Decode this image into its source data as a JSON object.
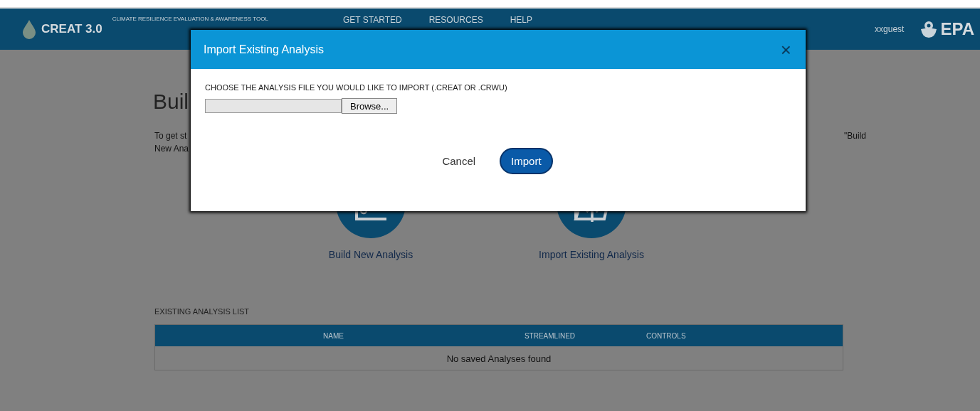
{
  "header": {
    "logo": "CREAT 3.0",
    "tagline": "CLIMATE RESILIENCE EVALUATION & AWARENESS TOOL",
    "nav": [
      {
        "label": "GET STARTED"
      },
      {
        "label": "RESOURCES"
      },
      {
        "label": "HELP"
      }
    ],
    "user": "xxguest",
    "agency_logo": "EPA"
  },
  "page": {
    "heading": "Buil",
    "intro_text": {
      "line_1_start": "To get st",
      "line_1_end": "\"Build",
      "line_2_start": "New Ana"
    },
    "actions": [
      {
        "kind": "build",
        "label": "Build New Analysis"
      },
      {
        "kind": "import",
        "label": "Import Existing Analysis"
      }
    ],
    "list_title": "EXISTING ANALYSIS LIST",
    "table": {
      "columns": [
        "NAME",
        "STREAMLINED",
        "CONTROLS"
      ],
      "empty_message": "No saved Analyses found"
    }
  },
  "dialog": {
    "title": "Import Existing Analysis",
    "close": "×",
    "prompt": "CHOOSE THE ANALYSIS FILE YOU WOULD LIKE TO IMPORT (.CREAT OR .CRWU)",
    "browse": "Browse...",
    "buttons": [
      {
        "kind": "secondary",
        "label": "Cancel"
      },
      {
        "kind": "primary",
        "label": "Import"
      }
    ]
  }
}
